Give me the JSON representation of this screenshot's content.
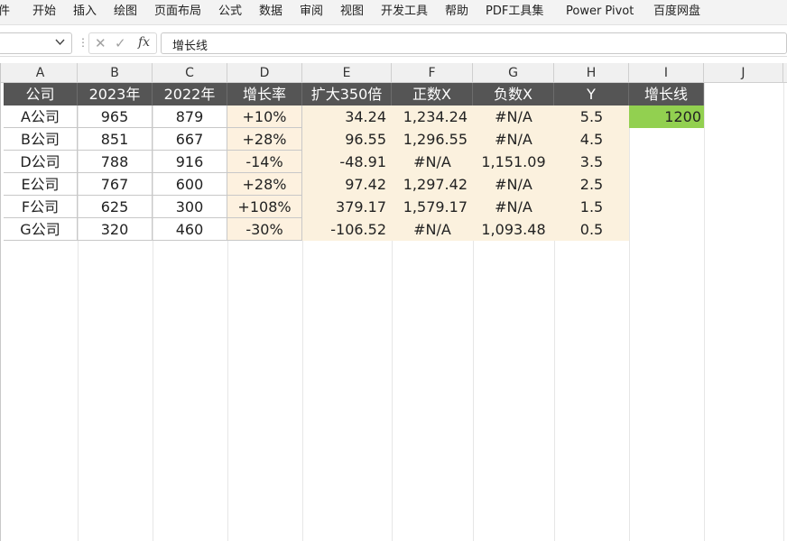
{
  "ribbon": {
    "tabs": [
      "件",
      "开始",
      "插入",
      "绘图",
      "页面布局",
      "公式",
      "数据",
      "审阅",
      "视图",
      "开发工具",
      "帮助",
      "PDF工具集",
      "Power Pivot",
      "百度网盘"
    ]
  },
  "formula_bar": {
    "name_box": "",
    "content": "增长线"
  },
  "grid": {
    "columns": [
      "A",
      "B",
      "C",
      "D",
      "E",
      "F",
      "G",
      "H",
      "I",
      "J"
    ],
    "header_row": [
      "公司",
      "2023年",
      "2022年",
      "增长率",
      "扩大350倍",
      "正数X",
      "负数X",
      "Y",
      "增长线"
    ],
    "data_rows": [
      [
        "A公司",
        "965",
        "879",
        "+10%",
        "34.24",
        "1,234.24",
        "#N/A",
        "5.5",
        "1200"
      ],
      [
        "B公司",
        "851",
        "667",
        "+28%",
        "96.55",
        "1,296.55",
        "#N/A",
        "4.5",
        ""
      ],
      [
        "D公司",
        "788",
        "916",
        "-14%",
        "-48.91",
        "#N/A",
        "1,151.09",
        "3.5",
        ""
      ],
      [
        "E公司",
        "767",
        "600",
        "+28%",
        "97.42",
        "1,297.42",
        "#N/A",
        "2.5",
        ""
      ],
      [
        "F公司",
        "625",
        "300",
        "+108%",
        "379.17",
        "1,579.17",
        "#N/A",
        "1.5",
        ""
      ],
      [
        "G公司",
        "320",
        "460",
        "-30%",
        "-106.52",
        "#N/A",
        "1,093.48",
        "0.5",
        ""
      ]
    ]
  },
  "colors": {
    "header_fill": "#555555",
    "calc_fill": "#fbf1de",
    "highlight_green": "#92d050"
  }
}
